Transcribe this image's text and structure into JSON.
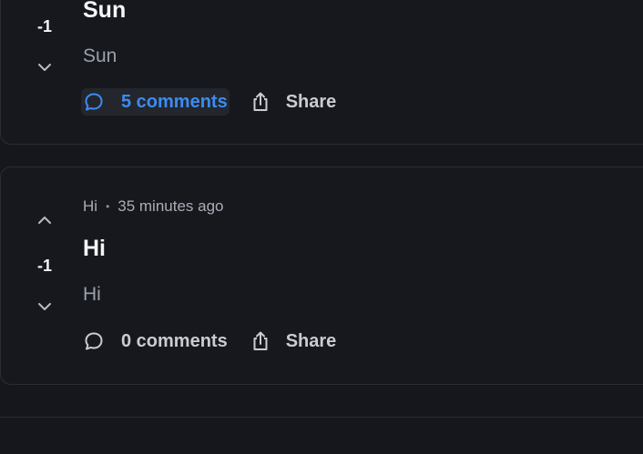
{
  "posts": [
    {
      "author": "",
      "time": "",
      "title": "Sun",
      "body": "Sun",
      "score": "-1",
      "comments_label": "5 comments",
      "share_label": "Share",
      "comments_active": true
    },
    {
      "author": "Hi",
      "time": "35 minutes ago",
      "title": "Hi",
      "body": "Hi",
      "score": "-1",
      "comments_label": "0 comments",
      "share_label": "Share",
      "comments_active": false
    }
  ],
  "colors": {
    "background": "#15171c",
    "card": "#16181d",
    "border": "#2a2d34",
    "accent": "#3d8bf2",
    "text": "#f5f6f8",
    "muted": "#a7adb8"
  },
  "icons": {
    "upvote": "chevron-up-icon",
    "downvote": "chevron-down-icon",
    "comments": "speech-bubble-icon",
    "share": "share-icon"
  }
}
